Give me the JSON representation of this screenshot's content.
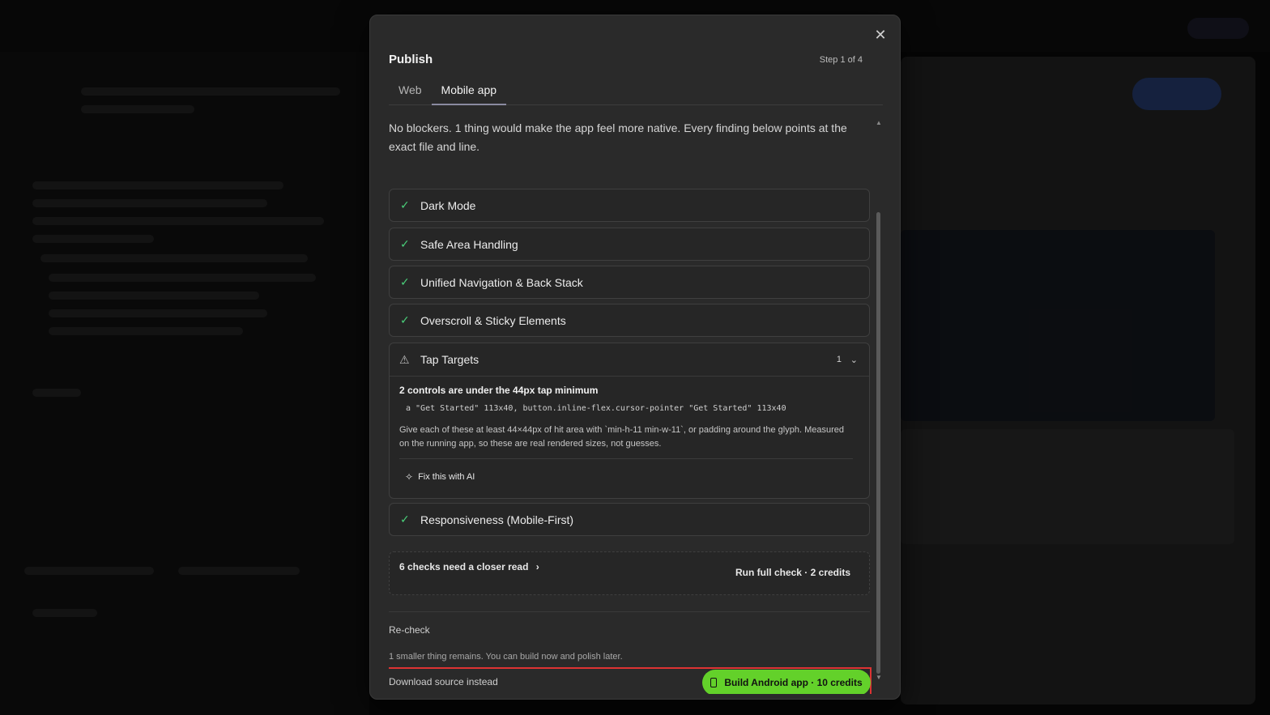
{
  "modal": {
    "title": "Publish",
    "step": "Step 1 of 4",
    "close_icon": "close-icon",
    "tabs": [
      {
        "label": "Web",
        "active": false
      },
      {
        "label": "Mobile app",
        "active": true
      }
    ]
  },
  "summary": "No blockers. 1 thing would make the app feel more native. Every finding below points at the exact file and line.",
  "checks": [
    {
      "label": "Dark Mode",
      "status": "pass"
    },
    {
      "label": "Safe Area Handling",
      "status": "pass"
    },
    {
      "label": "Unified Navigation & Back Stack",
      "status": "pass"
    },
    {
      "label": "Overscroll & Sticky Elements",
      "status": "pass"
    }
  ],
  "tap_targets": {
    "label": "Tap Targets",
    "status": "warning",
    "count": "1",
    "finding": "2 controls are under the 44px tap minimum",
    "code": "a \"Get Started\" 113x40, button.inline-flex.cursor-pointer \"Get Started\" 113x40",
    "description": "Give each of these at least 44×44px of hit area with `min-h-11 min-w-11`, or padding around the glyph. Measured on the running app, so these are real rendered sizes, not guesses.",
    "fix_label": "Fix this with AI"
  },
  "responsiveness": {
    "label": "Responsiveness (Mobile-First)",
    "status": "pass"
  },
  "closer_read": {
    "label": "6 checks need a closer read",
    "action": "Run full check · 2 credits"
  },
  "footer": {
    "recheck": "Re-check",
    "remains": "1 smaller thing remains. You can build now and polish later.",
    "download": "Download source instead",
    "build": "Build Android app · 10 credits"
  },
  "colors": {
    "accent_green": "#63d12a",
    "pass_green": "#4ad07a",
    "highlight_red": "#dd3333"
  }
}
